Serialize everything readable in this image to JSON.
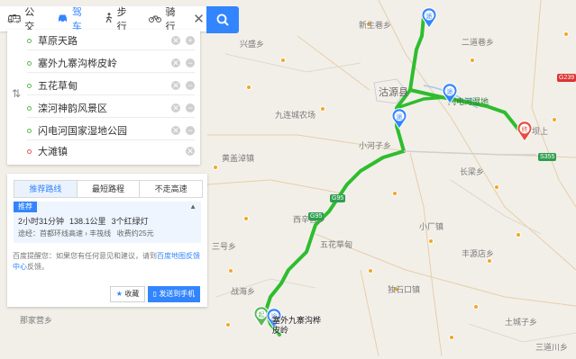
{
  "tabs": [
    {
      "label": "公交",
      "icon": "bus-icon"
    },
    {
      "label": "驾车",
      "icon": "car-icon"
    },
    {
      "label": "步行",
      "icon": "walk-icon"
    },
    {
      "label": "骑行",
      "icon": "bike-icon"
    }
  ],
  "active_tab": "驾车",
  "close_icon": "close-icon",
  "search_icon": "search-icon",
  "waypoints": [
    {
      "name": "草原天路"
    },
    {
      "name": "塞外九寨沟桦皮岭"
    },
    {
      "name": "五花草甸"
    },
    {
      "name": "滦河神韵风景区"
    },
    {
      "name": "闪电河国家湿地公园"
    },
    {
      "name": "大滩镇"
    }
  ],
  "route": {
    "tabs": [
      "推荐路线",
      "最短路程",
      "不走高速"
    ],
    "recommend_badge": "推荐",
    "duration": "2小时31分钟",
    "distance": "138.1公里",
    "lights": "3个红绿灯",
    "via": "途经：首都环线高速 › 丰筏线",
    "toll": "收费约25元",
    "tip_prefix": "百度提醒您：如果您有任何意见和建议，请到",
    "tip_link": "百度地图反馈中心",
    "tip_suffix": "反馈。",
    "fav_label": "收藏",
    "send_label": "发送到手机"
  },
  "map": {
    "labels": [
      {
        "text": "新生巷乡",
        "cls": ""
      },
      {
        "text": "二道巷乡",
        "cls": ""
      },
      {
        "text": "兴盛乡",
        "cls": ""
      },
      {
        "text": "沽源县",
        "cls": "big"
      },
      {
        "text": "闪电河湿地",
        "cls": "scenic"
      },
      {
        "text": "九连城农场",
        "cls": ""
      },
      {
        "text": "小河子乡",
        "cls": ""
      },
      {
        "text": "坝上",
        "cls": ""
      },
      {
        "text": "黄盖淖镇",
        "cls": ""
      },
      {
        "text": "长梁乡",
        "cls": ""
      },
      {
        "text": "西辛营乡",
        "cls": ""
      },
      {
        "text": "小厂镇",
        "cls": ""
      },
      {
        "text": "五花草甸",
        "cls": ""
      },
      {
        "text": "三号乡",
        "cls": ""
      },
      {
        "text": "丰源店乡",
        "cls": ""
      },
      {
        "text": "战海乡",
        "cls": ""
      },
      {
        "text": "独石口镇",
        "cls": ""
      },
      {
        "text": "土城子乡",
        "cls": ""
      },
      {
        "text": "那家营乡",
        "cls": ""
      },
      {
        "text": "三道川乡",
        "cls": ""
      }
    ],
    "badges": [
      {
        "text": "G239",
        "cls": "r"
      },
      {
        "text": "S355",
        "cls": "g"
      },
      {
        "text": "G95",
        "cls": "g"
      },
      {
        "text": "G95",
        "cls": "g"
      }
    ],
    "markers": [
      {
        "text": "途"
      },
      {
        "text": "途"
      },
      {
        "text": "途"
      },
      {
        "text": "终"
      },
      {
        "text": "起"
      },
      {
        "text": "途"
      }
    ],
    "scenic_label": "塞外九寨沟桦皮岭",
    "route_color": "#2ebd2e",
    "accent": "#3385ff"
  }
}
